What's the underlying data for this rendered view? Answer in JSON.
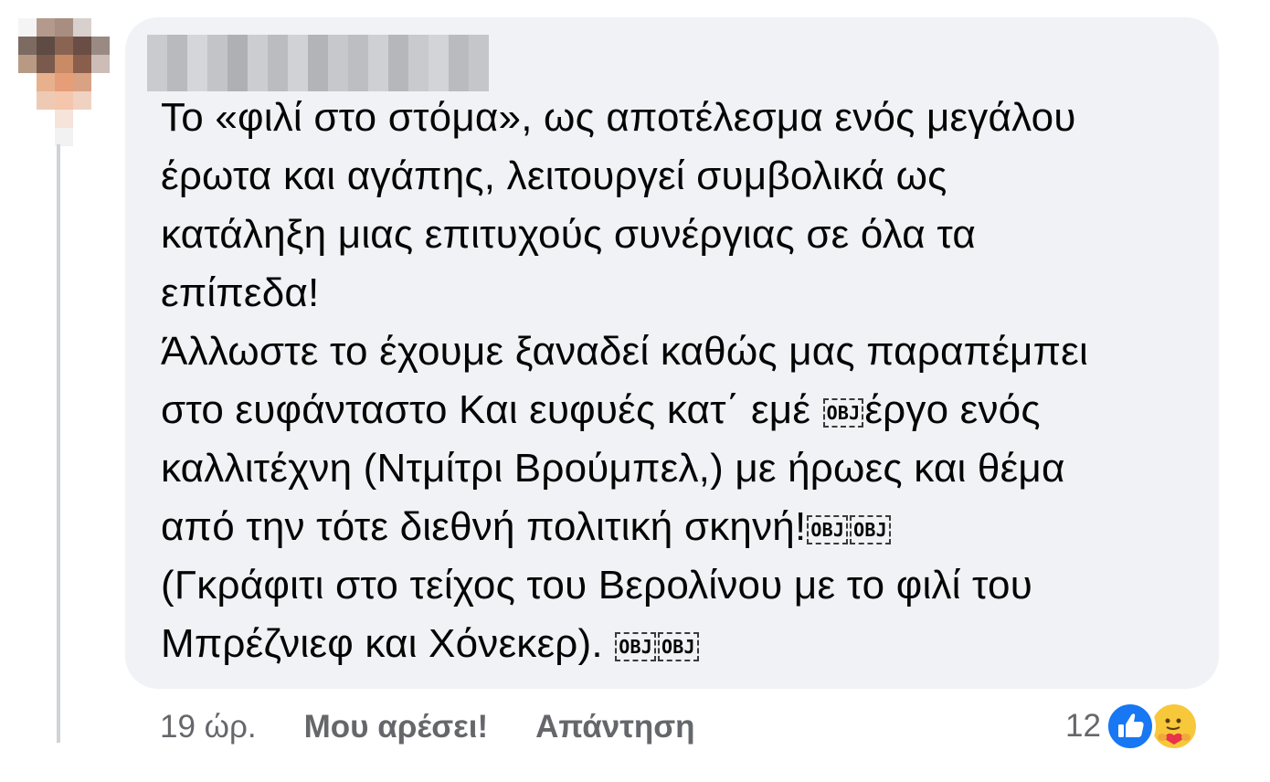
{
  "comment": {
    "text_lines": [
      "Το «φιλί στο στόμα», ως αποτέλεσμα ενός μεγάλου",
      "έρωτα και αγάπης, λειτουργεί συμβολικά ως",
      "κατάληξη μιας επιτυχούς συνέργιας σε όλα τα",
      "επίπεδα!",
      "Άλλωστε το έχουμε ξαναδεί καθώς μας παραπέμπει",
      "στο ευφάνταστο Και ευφυές κατ΄ εμέ ",
      "έργο ενός",
      "καλλιτέχνη (Ντμίτρι Βρούμπελ,) με ήρωες και θέμα",
      "από την τότε διεθνή πολιτική σκηνή!",
      "(Γκράφιτι στο τείχος του Βερολίνου με το φιλί του",
      "Μπρέζνιεφ και Χόνεκερ). "
    ],
    "obj_placeholder": "OBJ"
  },
  "actions": {
    "timestamp": "19 ώρ.",
    "like_label": "Μου αρέσει!",
    "reply_label": "Απάντηση"
  },
  "reactions": {
    "count": "12",
    "icons": [
      "like-icon",
      "care-icon"
    ]
  },
  "colors": {
    "bubble": "#f0f2f5",
    "text": "#050505",
    "secondary_text": "#65676b",
    "like_blue": "#1877f2",
    "care_yellow": "#f7c83a",
    "thread_line": "#cfd2d6"
  }
}
